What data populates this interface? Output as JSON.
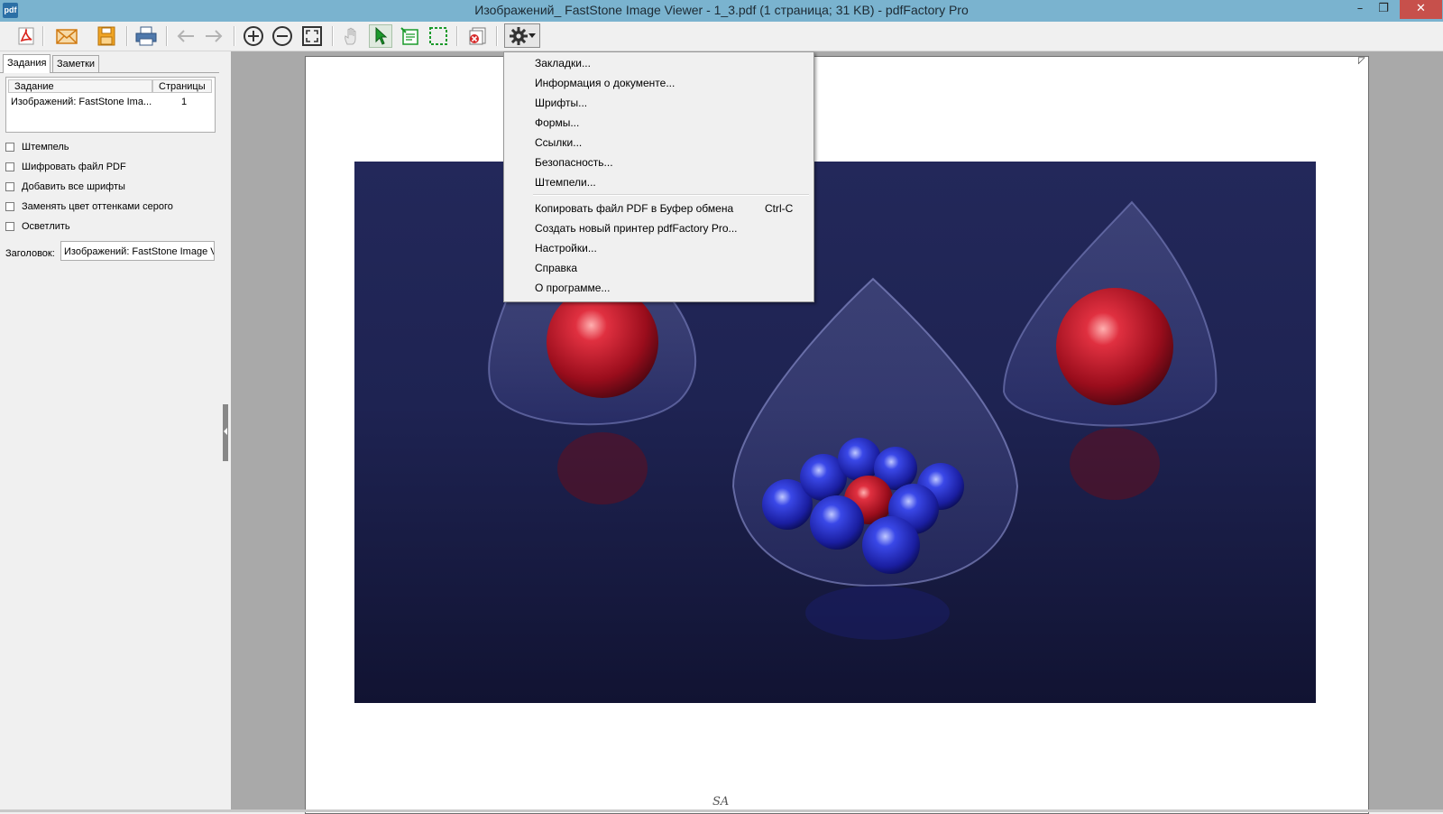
{
  "window": {
    "title": "Изображений_ FastStone Image Viewer - 1_3.pdf (1 страница; 31 KB) - pdfFactory Pro",
    "app_icon_text": "pdf",
    "min_glyph": "–",
    "max_glyph": "❐",
    "close_glyph": "✕"
  },
  "toolbar": {
    "buttons": [
      "pdf-save-icon",
      "email-icon",
      "save-icon",
      "print-icon",
      "back-arrow-icon",
      "forward-arrow-icon",
      "zoom-in-icon",
      "zoom-out-icon",
      "fit-page-icon",
      "hand-tool-icon",
      "select-arrow-icon",
      "text-select-icon",
      "area-select-icon",
      "delete-page-icon",
      "gear-icon"
    ]
  },
  "left_panel": {
    "tabs": [
      "Задания",
      "Заметки"
    ],
    "columns": [
      "Задание",
      "Страницы"
    ],
    "rows": [
      {
        "task": "Изображений: FastStone Ima...",
        "pages": "1"
      }
    ],
    "options": [
      {
        "label": "Штемпель",
        "checked": false
      },
      {
        "label": "Шифровать файл PDF",
        "checked": false
      },
      {
        "label": "Добавить все шрифты",
        "checked": false
      },
      {
        "label": "Заменять цвет оттенками серого",
        "checked": false
      },
      {
        "label": "Осветлить",
        "checked": false
      }
    ],
    "header_label": "Заголовок:",
    "header_value": "Изображений: FastStone Image V"
  },
  "page": {
    "watermark": "SA"
  },
  "menu": {
    "items": [
      {
        "label": "Закладки...",
        "shortcut": ""
      },
      {
        "label": "Информация о документе...",
        "shortcut": ""
      },
      {
        "label": "Шрифты...",
        "shortcut": ""
      },
      {
        "label": "Формы...",
        "shortcut": ""
      },
      {
        "label": "Ссылки...",
        "shortcut": ""
      },
      {
        "label": "Безопасность...",
        "shortcut": ""
      },
      {
        "label": "Штемпели...",
        "shortcut": ""
      },
      {
        "label": "Копировать файл PDF в Буфер обмена",
        "shortcut": "Ctrl-C"
      },
      {
        "label": "Создать новый принтер pdfFactory Pro...",
        "shortcut": ""
      },
      {
        "label": "Настройки...",
        "shortcut": ""
      },
      {
        "label": "Справка",
        "shortcut": ""
      },
      {
        "label": "О программе...",
        "shortcut": ""
      }
    ]
  },
  "colors": {
    "titlebar": "#7ab3cf",
    "close": "#c7504b",
    "viewer_bg": "#a9a9a9",
    "image_bg": "#1f2456"
  }
}
